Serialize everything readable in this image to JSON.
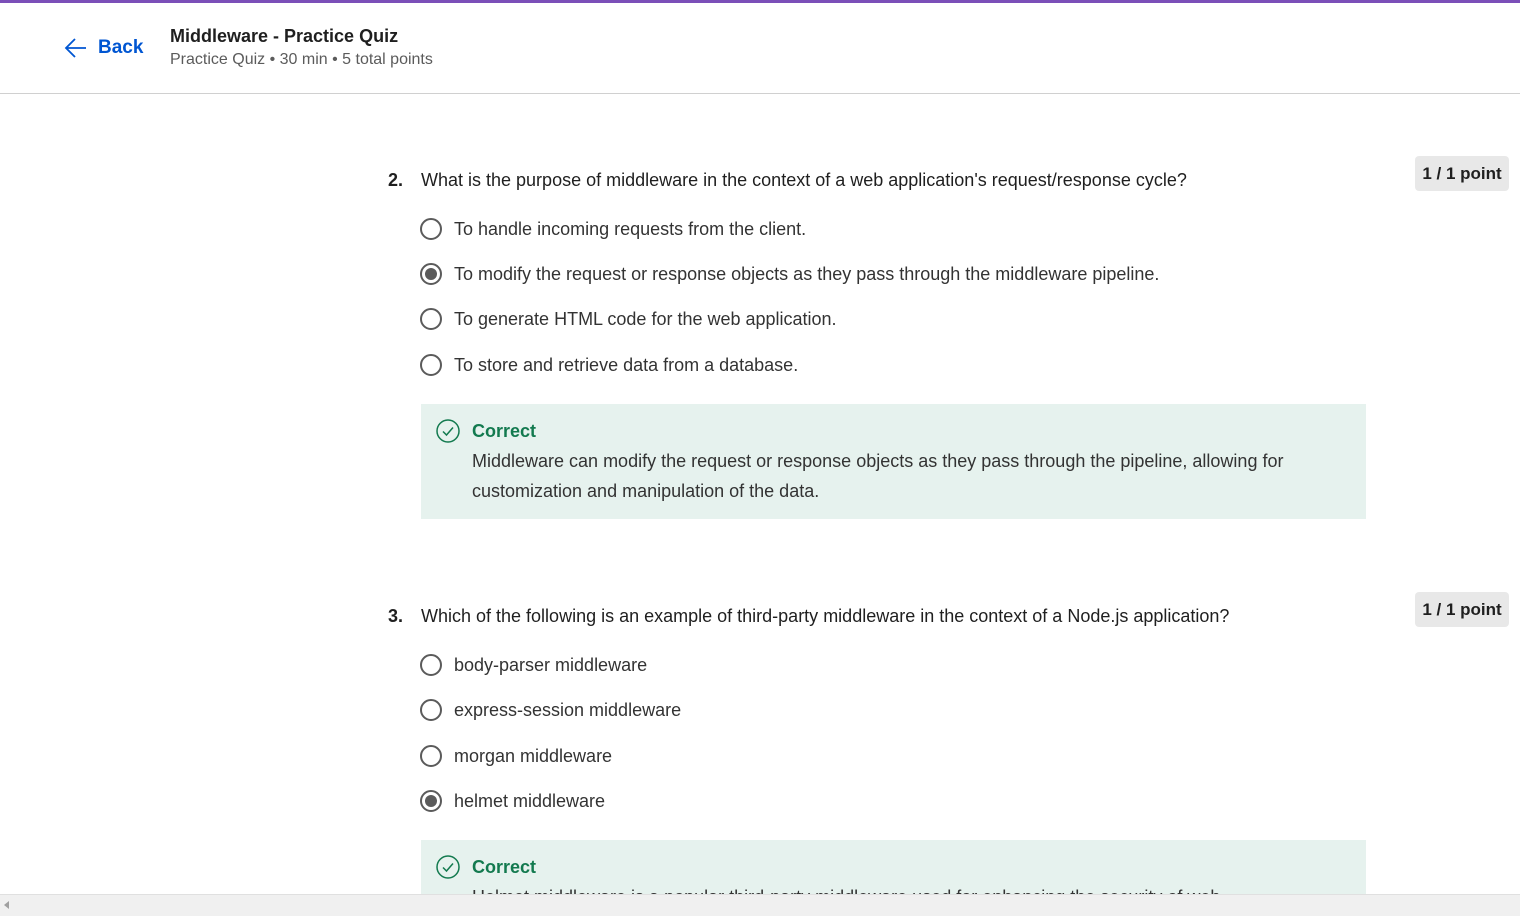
{
  "header": {
    "back_label": "Back",
    "title": "Middleware - Practice Quiz",
    "subtitle": "Practice Quiz • 30 min • 5 total points"
  },
  "questions": [
    {
      "number": "2.",
      "text": "What is the purpose of middleware in the context of a web application's request/response cycle?",
      "points": "1 / 1 point",
      "options": [
        {
          "label": "To handle incoming requests from the client.",
          "selected": false
        },
        {
          "label": "To modify the request or response objects as they pass through the middleware pipeline.",
          "selected": true
        },
        {
          "label": "To generate HTML code for the web application.",
          "selected": false
        },
        {
          "label": "To store and retrieve data from a database.",
          "selected": false
        }
      ],
      "feedback": {
        "title": "Correct",
        "text": "Middleware can modify the request or response objects as they pass through the pipeline, allowing for customization and manipulation of the data."
      }
    },
    {
      "number": "3.",
      "text": "Which of the following is an example of third-party middleware in the context of a Node.js application?",
      "points": "1 / 1 point",
      "options": [
        {
          "label": "body-parser middleware",
          "selected": false
        },
        {
          "label": "express-session middleware",
          "selected": false
        },
        {
          "label": "morgan middleware",
          "selected": false
        },
        {
          "label": "helmet middleware",
          "selected": true
        }
      ],
      "feedback": {
        "title": "Correct",
        "text": "Helmet middleware is a popular third-party middleware used for enhancing the security of web"
      }
    }
  ],
  "colors": {
    "accent_line": "#7b4fb8",
    "link": "#0056d2",
    "correct": "#137a4f",
    "feedback_bg": "#e6f2ee"
  }
}
